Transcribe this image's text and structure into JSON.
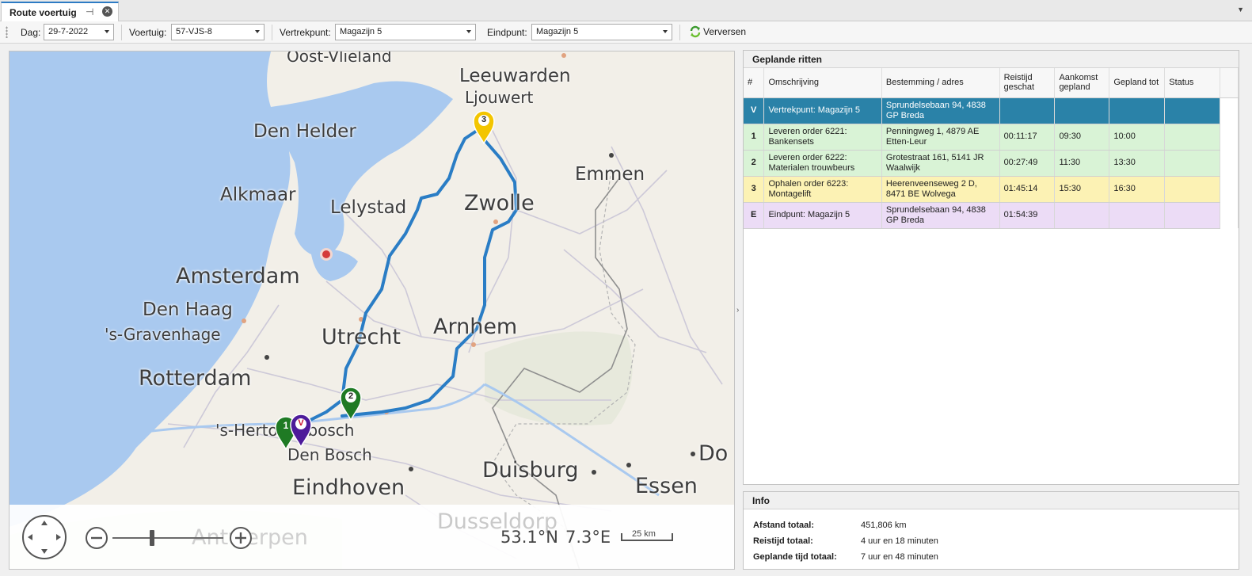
{
  "tab": {
    "title": "Route voertuig",
    "pin_icon": "pin-icon",
    "close_icon": "close-icon"
  },
  "toolbar": {
    "dag_label": "Dag:",
    "dag_value": "29-7-2022",
    "voertuig_label": "Voertuig:",
    "voertuig_value": "57-VJS-8",
    "vertrekpunt_label": "Vertrekpunt:",
    "vertrekpunt_value": "Magazijn 5",
    "eindpunt_label": "Eindpunt:",
    "eindpunt_value": "Magazijn 5",
    "refresh_label": "Verversen"
  },
  "map": {
    "labels": {
      "oost_vlieland": "Oost-Vlieland",
      "leeuwarden": "Leeuwarden",
      "ljouwert": "Ljouwert",
      "den_helder": "Den Helder",
      "emmen": "Emmen",
      "alkmaar": "Alkmaar",
      "lelystad": "Lelystad",
      "zwolle": "Zwolle",
      "amsterdam": "Amsterdam",
      "den_haag": "Den Haag",
      "s_gravenhage": "'s-Gravenhage",
      "utrecht": "Utrecht",
      "arnhem": "Arnhem",
      "rotterdam": "Rotterdam",
      "s_hertogenbosch": "'s-Hertogenbosch",
      "den_bosch": "Den Bosch",
      "eindhoven": "Eindhoven",
      "duisburg": "Duisburg",
      "essen": "Essen",
      "do": "Do",
      "dusseldorf": "Dusseldorp",
      "antwerpen": "Antwerpen"
    },
    "markers": {
      "m1": "1",
      "mv": "V",
      "m2": "2",
      "m3": "3"
    },
    "lat": "53.1°N",
    "lon": "7.3°E",
    "scale": "25 km",
    "colors": {
      "route": "#2a7dc5",
      "water": "#a9c9ef",
      "marker_green": "#1f7a24",
      "marker_purple": "#4d1b9a",
      "marker_yellow": "#f3c500"
    }
  },
  "grid": {
    "title": "Geplande ritten",
    "columns": [
      "#",
      "Omschrijving",
      "Bestemming / adres",
      "Reistijd\ngeschat",
      "Aankomst\ngepland",
      "Gepland tot",
      "Status"
    ],
    "rows": [
      {
        "num": "V",
        "desc": "Vertrekpunt: Magazijn 5",
        "addr": "Sprundelsebaan 94, 4838\nGP Breda",
        "reistijd": "",
        "aankomst": "",
        "tot": "",
        "status": "",
        "style": "row-sel"
      },
      {
        "num": "1",
        "desc": "Leveren order 6221:\nBankensets",
        "addr": "Penningweg 1, 4879 AE\nEtten-Leur",
        "reistijd": "00:11:17",
        "aankomst": "09:30",
        "tot": "10:00",
        "status": "",
        "style": "row-green"
      },
      {
        "num": "2",
        "desc": "Leveren order 6222:\nMaterialen trouwbeurs",
        "addr": "Grotestraat 161, 5141 JR\nWaalwijk",
        "reistijd": "00:27:49",
        "aankomst": "11:30",
        "tot": "13:30",
        "status": "",
        "style": "row-green"
      },
      {
        "num": "3",
        "desc": "Ophalen order 6223:\nMontagelift",
        "addr": "Heerenveenseweg 2 D,\n8471 BE Wolvega",
        "reistijd": "01:45:14",
        "aankomst": "15:30",
        "tot": "16:30",
        "status": "",
        "style": "row-yellow"
      },
      {
        "num": "E",
        "desc": "Eindpunt: Magazijn 5",
        "addr": "Sprundelsebaan 94, 4838\nGP Breda",
        "reistijd": "01:54:39",
        "aankomst": "",
        "tot": "",
        "status": "",
        "style": "row-purple"
      }
    ]
  },
  "info": {
    "title": "Info",
    "afstand_label": "Afstand totaal:",
    "afstand_value": "451,806 km",
    "reistijd_label": "Reistijd totaal:",
    "reistijd_value": "4 uur en 18 minuten",
    "gepland_label": "Geplande tijd totaal:",
    "gepland_value": "7 uur en 48 minuten"
  }
}
